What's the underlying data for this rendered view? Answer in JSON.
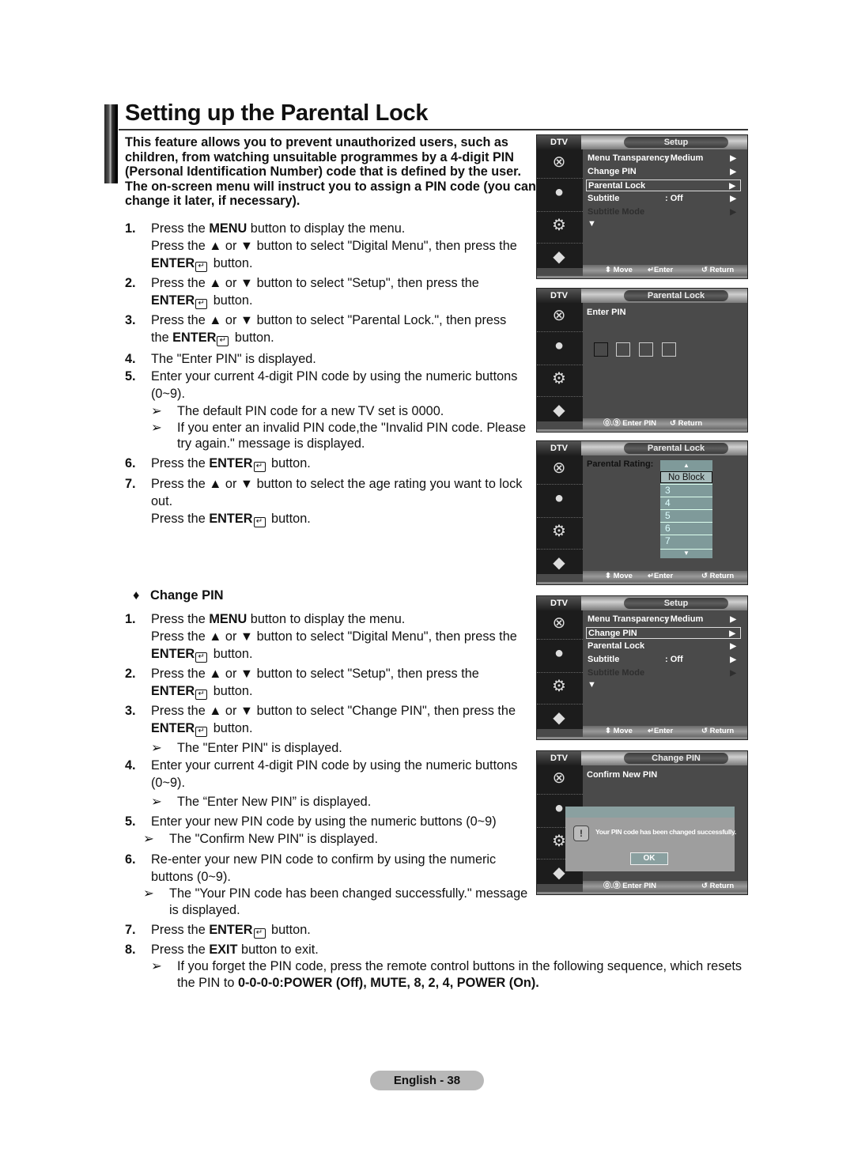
{
  "title": "Setting up the Parental Lock",
  "intro": "This feature allows you to prevent unauthorized users, such as children, from watching unsuitable programmes by a 4-digit PIN (Personal Identification Number) code that is defined by the user. The on-screen menu will instruct you to assign a PIN code (you can change it later, if necessary).",
  "parental_steps": {
    "s1": {
      "num": "1.",
      "a1": "Press the ",
      "b1": "MENU",
      "a2": " button to display the menu.",
      "l2": "Press the ▲ or ▼ button to select \"Digital Menu\", then press the",
      "b2": "ENTER",
      "a3": " button."
    },
    "s2": {
      "num": "2.",
      "l1": "Press the ▲ or ▼ button to select \"Setup\", then press the",
      "b": "ENTER",
      "a": " button."
    },
    "s3": {
      "num": "3.",
      "l1": "Press the ▲ or ▼ button to select \"Parental Lock.\", then press",
      "pre": "the ",
      "b": "ENTER",
      "a": " button."
    },
    "s4": {
      "num": "4.",
      "text": "The \"Enter PIN\" is displayed."
    },
    "s5": {
      "num": "5.",
      "text": "Enter your current 4-digit PIN code by using the numeric buttons (0~9).",
      "note1": "The default PIN code for a new TV set is 0000.",
      "note2": "If you enter an invalid PIN code,the \"Invalid PIN code. Please try again.\" message is displayed."
    },
    "s6": {
      "num": "6.",
      "pre": "Press the ",
      "b": "ENTER",
      "a": " button."
    },
    "s7": {
      "num": "7.",
      "text": "Press the ▲ or ▼ button to select the age rating you want to lock out.",
      "pre": "Press the ",
      "b": "ENTER",
      "a": " button."
    }
  },
  "change_pin": {
    "heading": "Change PIN",
    "bullet": "♦",
    "s1": {
      "num": "1.",
      "a1": "Press the ",
      "b1": "MENU",
      "a2": " button to display the menu.",
      "l2": "Press the ▲ or ▼ button to select \"Digital Menu\", then press the",
      "b2": "ENTER",
      "a3": " button."
    },
    "s2": {
      "num": "2.",
      "l1": "Press the ▲ or ▼ button to select \"Setup\", then press the",
      "b": "ENTER",
      "a": " button."
    },
    "s3": {
      "num": "3.",
      "l1": "Press the ▲ or ▼ button to select \"Change PIN\", then press the",
      "b": "ENTER",
      "a": " button.",
      "note": "The \"Enter PIN\" is displayed."
    },
    "s4": {
      "num": "4.",
      "text": "Enter your current 4-digit PIN code by using the numeric buttons (0~9).",
      "note": "The “Enter New PIN” is displayed."
    },
    "s5": {
      "num": "5.",
      "text": "Enter your new PIN code by using the numeric buttons (0~9)",
      "note": "The \"Confirm New PIN\" is displayed."
    },
    "s6": {
      "num": "6.",
      "text": "Re-enter your new PIN code to confirm by using the numeric buttons (0~9).",
      "note": "The \"Your PIN code has been changed successfully.\" message is displayed."
    },
    "s7": {
      "num": "7.",
      "pre": "Press the ",
      "b": "ENTER",
      "a": " button."
    },
    "s8": {
      "num": "8.",
      "pre": "Press the ",
      "b": "EXIT",
      "a": " button to exit.",
      "note_a": "If you forget the PIN code, press the remote control buttons in the following sequence, which resets the PIN to ",
      "note_b": "0-0-0-0:POWER (Off), MUTE, 8, 2, 4, POWER (On)."
    }
  },
  "note_arrow": "➢",
  "enter_glyph": "↵",
  "tv_common": {
    "dtv": "DTV",
    "foot_move": "⬍ Move",
    "foot_enter": "↵Enter",
    "foot_return": "↺ Return",
    "foot_enter_pin": "⓪.⑨ Enter PIN",
    "arrow_right": "▶",
    "more": "▼"
  },
  "screen1": {
    "tab": "Setup",
    "rows": [
      {
        "label": "Menu Transparency",
        "value": ": Medium"
      },
      {
        "label": "Change PIN",
        "value": ""
      },
      {
        "label": "Parental Lock",
        "value": "",
        "selected": true
      },
      {
        "label": "Subtitle",
        "value": ": Off"
      },
      {
        "label": "Subtitle Mode",
        "value": "",
        "disabled": true
      }
    ]
  },
  "screen2": {
    "tab": "Parental Lock",
    "label": "Enter PIN"
  },
  "screen3": {
    "tab": "Parental Lock",
    "label": "Parental Rating:",
    "options": [
      "No Block",
      "3",
      "4",
      "5",
      "6",
      "7"
    ],
    "selected": "No Block"
  },
  "screen4": {
    "tab": "Setup",
    "rows": [
      {
        "label": "Menu Transparency",
        "value": ": Medium"
      },
      {
        "label": "Change PIN",
        "value": "",
        "selected": true
      },
      {
        "label": "Parental Lock",
        "value": ""
      },
      {
        "label": "Subtitle",
        "value": ": Off"
      },
      {
        "label": "Subtitle Mode",
        "value": "",
        "disabled": true
      }
    ]
  },
  "screen5": {
    "tab": "Change PIN",
    "label": "Confirm New PIN",
    "dialog_icon": "!",
    "dialog_message": "Your PIN code has been changed successfully.",
    "dialog_ok": "OK"
  },
  "footer": {
    "page": "English - 38"
  }
}
